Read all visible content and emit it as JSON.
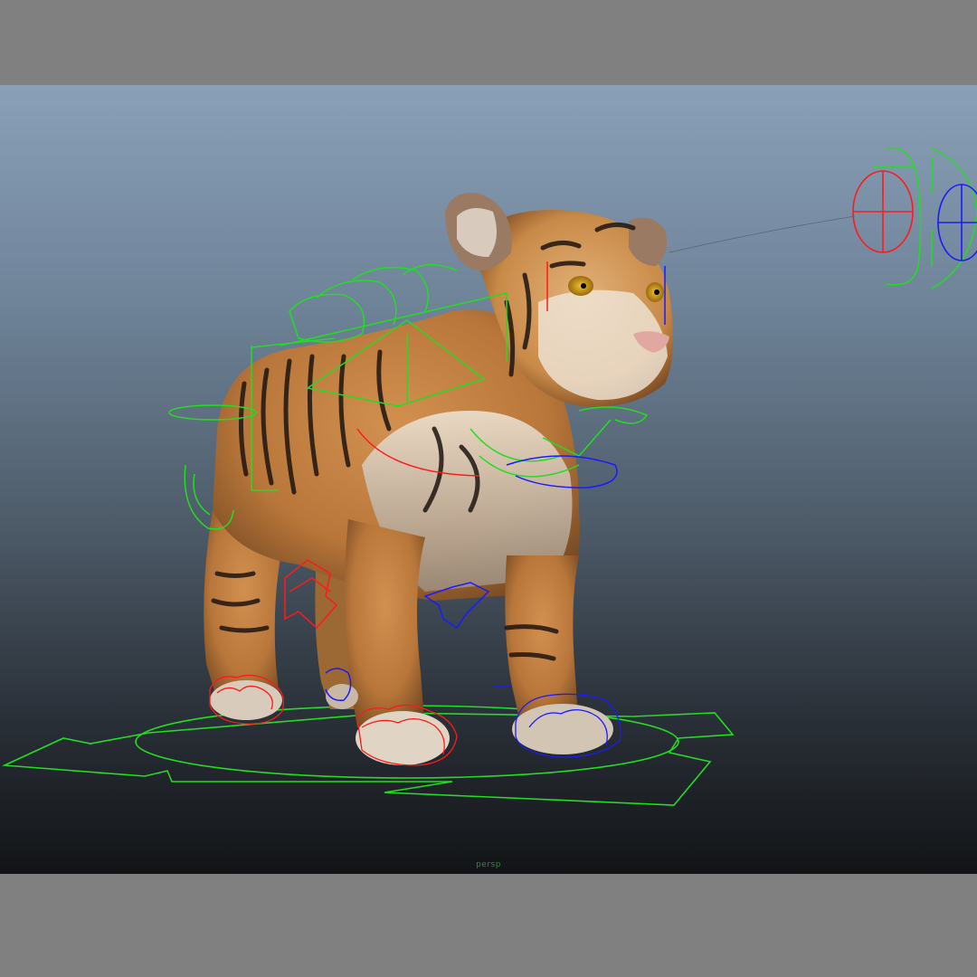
{
  "viewport": {
    "camera_label": "persp",
    "background_top": "#8aa0b8",
    "background_bottom": "#121416"
  },
  "scene": {
    "model": "tiger-cub",
    "fur_color": "#b8763a",
    "stripe_color": "#1e1510",
    "belly_color": "#e6ddd0",
    "control_colors": {
      "center": "#22dd22",
      "left": "#ff1a1a",
      "right": "#1a1aff"
    }
  },
  "icons": [
    "root-control-icon",
    "paw-control-icon",
    "head-control-icon",
    "eye-aim-control-icon",
    "spine-control-icon"
  ]
}
